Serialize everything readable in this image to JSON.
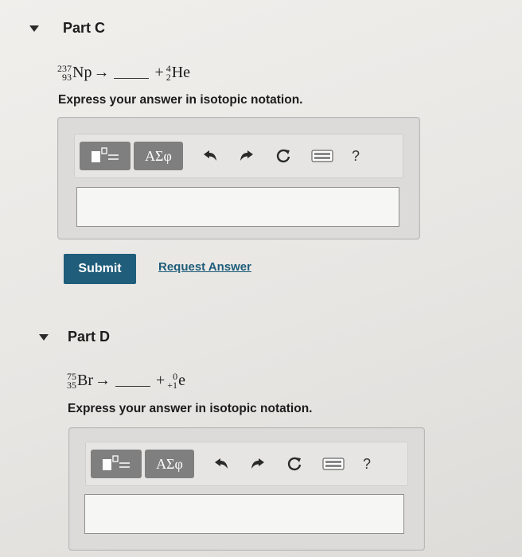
{
  "part_c": {
    "title": "Part C",
    "reactant": {
      "mass": "237",
      "atomic": "93",
      "symbol": "Np"
    },
    "arrow": "→",
    "plus": "+",
    "product": {
      "mass": "4",
      "atomic": "2",
      "symbol": "He"
    },
    "instruction": "Express your answer in isotopic notation.",
    "toolbar": {
      "greek_label": "ΑΣφ",
      "help_label": "?"
    },
    "answer_value": "",
    "submit_label": "Submit",
    "request_label": "Request Answer"
  },
  "part_d": {
    "title": "Part D",
    "reactant": {
      "mass": "75",
      "atomic": "35",
      "symbol": "Br"
    },
    "arrow": "→",
    "plus": "+",
    "product": {
      "mass": "0",
      "atomic": "+1",
      "symbol": "e"
    },
    "instruction": "Express your answer in isotopic notation.",
    "toolbar": {
      "greek_label": "ΑΣφ",
      "help_label": "?"
    },
    "answer_value": ""
  },
  "icons": {
    "template": "template-icon",
    "undo": "undo-icon",
    "redo": "redo-icon",
    "reset": "reset-icon",
    "keyboard": "keyboard-icon"
  },
  "colors": {
    "accent": "#1f5d7a",
    "toolbar_button": "#7f7f7f"
  }
}
